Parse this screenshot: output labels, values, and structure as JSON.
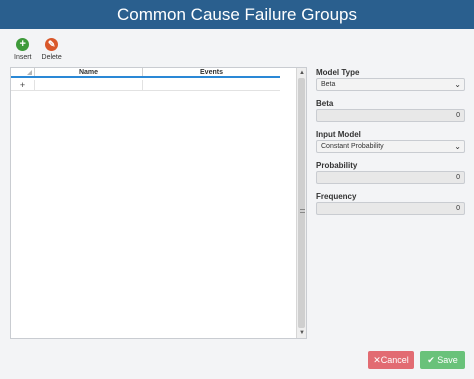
{
  "window": {
    "title": "Common Cause Failure Groups"
  },
  "toolbar": {
    "insert_label": "Insert",
    "delete_label": "Delete"
  },
  "grid": {
    "columns": [
      "Name",
      "Events"
    ],
    "new_row_symbol": "+"
  },
  "properties": {
    "model_type": {
      "label": "Model Type",
      "value": "Beta"
    },
    "beta": {
      "label": "Beta",
      "value": "0"
    },
    "input_model": {
      "label": "Input Model",
      "value": "Constant Probability"
    },
    "probability": {
      "label": "Probability",
      "value": "0"
    },
    "frequency": {
      "label": "Frequency",
      "value": "0"
    }
  },
  "footer": {
    "cancel_label": "Cancel",
    "save_label": "Save"
  },
  "colors": {
    "title_bar": "#2a5f8e",
    "accent": "#2a88d6",
    "cancel": "#e26b72",
    "save": "#69c27a"
  }
}
